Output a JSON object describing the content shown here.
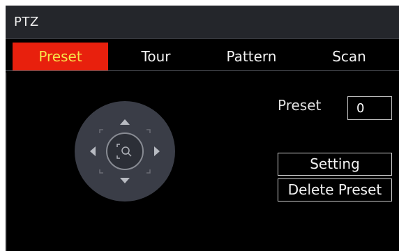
{
  "window": {
    "title": "PTZ"
  },
  "tabs": [
    {
      "label": "Preset",
      "active": true
    },
    {
      "label": "Tour",
      "active": false
    },
    {
      "label": "Pattern",
      "active": false
    },
    {
      "label": "Scan",
      "active": false
    }
  ],
  "preset": {
    "label": "Preset",
    "value": "0"
  },
  "buttons": {
    "setting": "Setting",
    "delete_preset": "Delete Preset"
  },
  "dpad": {
    "icons": [
      "arrow-up-icon",
      "arrow-down-icon",
      "arrow-left-icon",
      "arrow-right-icon",
      "focus-center-icon"
    ]
  },
  "colors": {
    "active_tab_bg": "#e8200d",
    "active_tab_text": "#f7e34a",
    "titlebar_bg": "#24262b",
    "dpad_bg": "#3a3d47"
  }
}
